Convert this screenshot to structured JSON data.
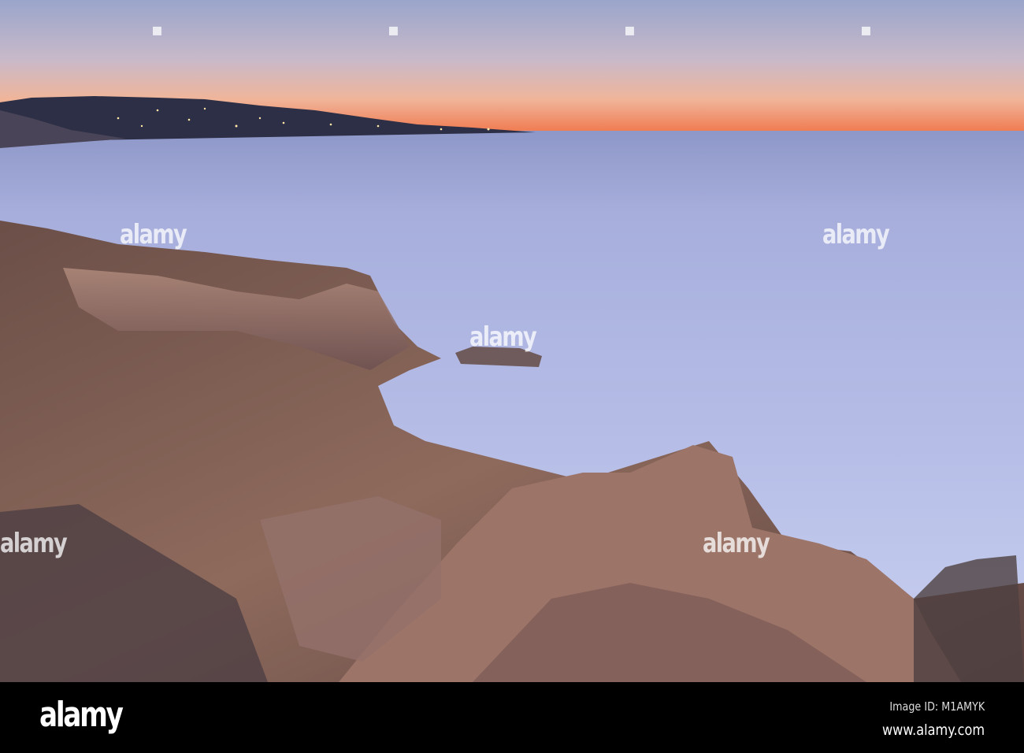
{
  "photo": {
    "subject": "coastal cliffs at dusk",
    "colors": {
      "sky_top": "#9ea8cc",
      "sky_horizon": "#f0875a",
      "ocean": "#aab2e0",
      "cliff": "#8a6656",
      "bar": "#000000"
    }
  },
  "watermark": {
    "text": "alamy"
  },
  "footer": {
    "logo": "alamy",
    "image_id": "Image ID: M1AMYK",
    "url": "www.alamy.com"
  }
}
